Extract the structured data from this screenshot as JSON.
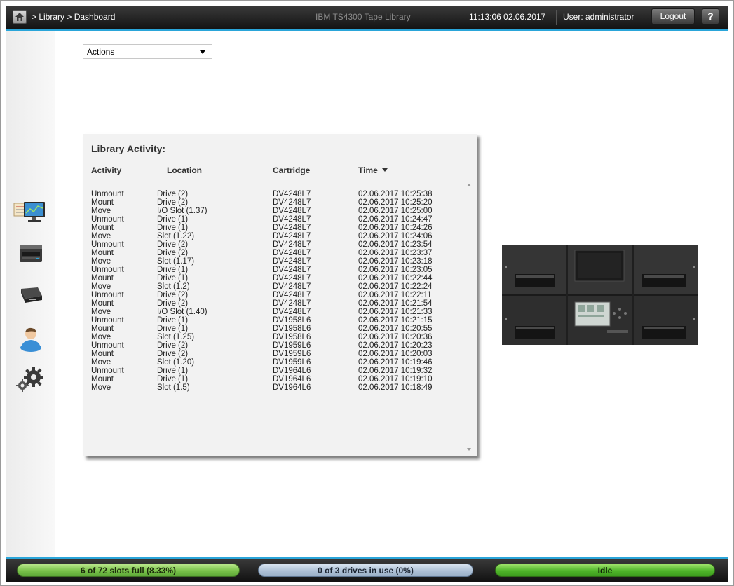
{
  "header": {
    "breadcrumb": "> Library > Dashboard",
    "app_title": "IBM TS4300 Tape Library",
    "clock": "11:13:06  02.06.2017",
    "user": "User: administrator",
    "logout_label": "Logout",
    "help_label": "?"
  },
  "sidebar": {
    "items": [
      {
        "icon": "monitoring-icon"
      },
      {
        "icon": "library-icon"
      },
      {
        "icon": "drive-icon"
      },
      {
        "icon": "user-icon"
      },
      {
        "icon": "settings-icon"
      }
    ]
  },
  "actions": {
    "label": "Actions"
  },
  "activity": {
    "title": "Library Activity:",
    "columns": {
      "activity": "Activity",
      "location": "Location",
      "cartridge": "Cartridge",
      "time": "Time"
    },
    "rows": [
      {
        "activity": "Unmount",
        "location": "Drive (2)",
        "cartridge": "DV4248L7",
        "time": "02.06.2017 10:25:38"
      },
      {
        "activity": "Mount",
        "location": "Drive (2)",
        "cartridge": "DV4248L7",
        "time": "02.06.2017 10:25:20"
      },
      {
        "activity": "Move",
        "location": "I/O Slot (1.37)",
        "cartridge": "DV4248L7",
        "time": "02.06.2017 10:25:00"
      },
      {
        "activity": "Unmount",
        "location": "Drive (1)",
        "cartridge": "DV4248L7",
        "time": "02.06.2017 10:24:47"
      },
      {
        "activity": "Mount",
        "location": "Drive (1)",
        "cartridge": "DV4248L7",
        "time": "02.06.2017 10:24:26"
      },
      {
        "activity": "Move",
        "location": "Slot (1.22)",
        "cartridge": "DV4248L7",
        "time": "02.06.2017 10:24:06"
      },
      {
        "activity": "Unmount",
        "location": "Drive (2)",
        "cartridge": "DV4248L7",
        "time": "02.06.2017 10:23:54"
      },
      {
        "activity": "Mount",
        "location": "Drive (2)",
        "cartridge": "DV4248L7",
        "time": "02.06.2017 10:23:37"
      },
      {
        "activity": "Move",
        "location": "Slot (1.17)",
        "cartridge": "DV4248L7",
        "time": "02.06.2017 10:23:18"
      },
      {
        "activity": "Unmount",
        "location": "Drive (1)",
        "cartridge": "DV4248L7",
        "time": "02.06.2017 10:23:05"
      },
      {
        "activity": "Mount",
        "location": "Drive (1)",
        "cartridge": "DV4248L7",
        "time": "02.06.2017 10:22:44"
      },
      {
        "activity": "Move",
        "location": "Slot (1.2)",
        "cartridge": "DV4248L7",
        "time": "02.06.2017 10:22:24"
      },
      {
        "activity": "Unmount",
        "location": "Drive (2)",
        "cartridge": "DV4248L7",
        "time": "02.06.2017 10:22:11"
      },
      {
        "activity": "Mount",
        "location": "Drive (2)",
        "cartridge": "DV4248L7",
        "time": "02.06.2017 10:21:54"
      },
      {
        "activity": "Move",
        "location": "I/O Slot (1.40)",
        "cartridge": "DV4248L7",
        "time": "02.06.2017 10:21:33"
      },
      {
        "activity": "Unmount",
        "location": "Drive (1)",
        "cartridge": "DV1958L6",
        "time": "02.06.2017 10:21:15"
      },
      {
        "activity": "Mount",
        "location": "Drive (1)",
        "cartridge": "DV1958L6",
        "time": "02.06.2017 10:20:55"
      },
      {
        "activity": "Move",
        "location": "Slot (1.25)",
        "cartridge": "DV1958L6",
        "time": "02.06.2017 10:20:36"
      },
      {
        "activity": "Unmount",
        "location": "Drive (2)",
        "cartridge": "DV1959L6",
        "time": "02.06.2017 10:20:23"
      },
      {
        "activity": "Mount",
        "location": "Drive (2)",
        "cartridge": "DV1959L6",
        "time": "02.06.2017 10:20:03"
      },
      {
        "activity": "Move",
        "location": "Slot (1.20)",
        "cartridge": "DV1959L6",
        "time": "02.06.2017 10:19:46"
      },
      {
        "activity": "Unmount",
        "location": "Drive (1)",
        "cartridge": "DV1964L6",
        "time": "02.06.2017 10:19:32"
      },
      {
        "activity": "Mount",
        "location": "Drive (1)",
        "cartridge": "DV1964L6",
        "time": "02.06.2017 10:19:10"
      },
      {
        "activity": "Move",
        "location": "Slot (1.5)",
        "cartridge": "DV1964L6",
        "time": "02.06.2017 10:18:49"
      }
    ]
  },
  "status": {
    "slots_label": "6 of 72 slots full (8.33%)",
    "slots_fraction": 0.0833,
    "drives_label": "0 of 3 drives in use (0%)",
    "drives_fraction": 0,
    "state_label": "Idle"
  },
  "colors": {
    "accent": "#2aa5d9",
    "slots_fill": "#79c24a",
    "drives_fill": "#aec1d6",
    "idle_fill": "#4fb52a"
  }
}
